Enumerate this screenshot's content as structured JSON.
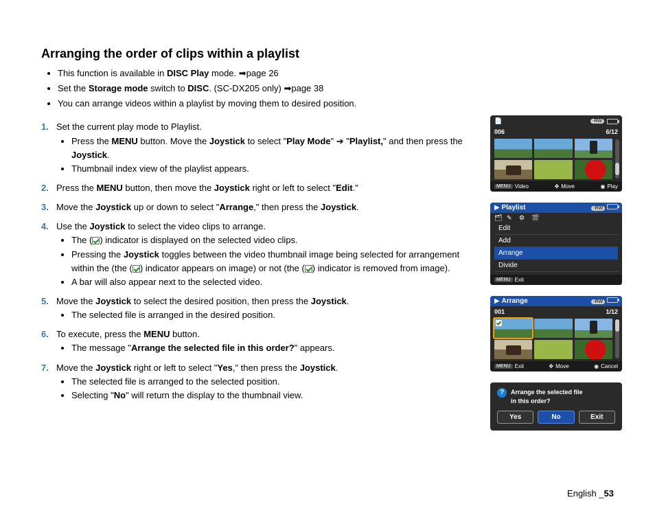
{
  "heading": "Arranging the order of clips within a playlist",
  "intro": [
    {
      "pre": "This function is available in ",
      "b": "DISC Play",
      "post": " mode. ",
      "ref": "page 26"
    },
    {
      "pre": "Set the ",
      "b": "Storage mode",
      "mid": " switch to ",
      "b2": "DISC",
      "post": ". (SC-DX205 only) ",
      "ref": "page 38"
    },
    {
      "pre": "You can arrange videos within a playlist by moving them to desired position."
    }
  ],
  "steps": {
    "s1": {
      "num": "1.",
      "text": "Set the current play mode to Playlist.",
      "sub1_pre": "Press the ",
      "menu": "MENU",
      "sub1_mid1": " button. Move the ",
      "joy": "Joystick",
      "sub1_mid2": " to select \"",
      "playmode": "Play Mode",
      "sub1_mid3": "\" ➔ \"",
      "playlist": "Playlist,",
      "sub1_mid4": "\" and then press the ",
      "sub2": "Thumbnail index view of the playlist appears."
    },
    "s2": {
      "num": "2.",
      "pre": "Press the ",
      "menu": "MENU",
      "mid1": " button, then move the ",
      "joy": "Joystick",
      "mid2": " right or left to select \"",
      "edit": "Edit",
      "post": ".\""
    },
    "s3": {
      "num": "3.",
      "pre": "Move the ",
      "joy": "Joystick",
      "mid1": " up or down to select \"",
      "arrange": "Arrange",
      "mid2": ",\" then press the ",
      "post": "."
    },
    "s4": {
      "num": "4.",
      "pre": "Use the ",
      "joy": "Joystick",
      "post": " to select the video clips to arrange.",
      "sub1_pre": "The (",
      "sub1_post": ") indicator is displayed on the selected video clips.",
      "sub2_pre": "Pressing the ",
      "sub2_mid1": " toggles between the video thumbnail image being selected for arrangement within the (the (",
      "sub2_mid2": ") indicator appears on image) or not (the (",
      "sub2_post": ") indicator is removed from image).",
      "sub3": "A bar will also appear next to the selected video."
    },
    "s5": {
      "num": "5.",
      "pre": "Move the ",
      "joy": "Joystick",
      "mid": " to select the desired position, then press the ",
      "post": ".",
      "sub1": "The selected file is arranged in the desired position."
    },
    "s6": {
      "num": "6.",
      "pre": "To execute, press the ",
      "menu": "MENU",
      "post": " button.",
      "sub1_pre": "The message \"",
      "msg": "Arrange the selected file in this order?",
      "sub1_post": "\" appears."
    },
    "s7": {
      "num": "7.",
      "pre": "Move the ",
      "joy": "Joystick",
      "mid1": " right or left to select \"",
      "yes": "Yes",
      "mid2": ",\" then press the ",
      "post": ".",
      "sub1": "The selected file is arranged to the selected position.",
      "sub2_pre": "Selecting \"",
      "no": "No",
      "sub2_post": "\" will return the display to the thumbnail view."
    }
  },
  "footer": {
    "lang": "English ",
    "sep": "_",
    "page": "53"
  },
  "screens": {
    "s1": {
      "counter_l": "006",
      "counter_r": "6/12",
      "bot_l": "Video",
      "bot_m": "Move",
      "bot_r": "Play",
      "menu": "MENU"
    },
    "s2": {
      "title": "Playlist",
      "items": [
        "Edit",
        "Add",
        "Arrange",
        "Divide"
      ],
      "bot": "Exit",
      "menu": "MENU"
    },
    "s3": {
      "title": "Arrange",
      "counter_l": "001",
      "counter_r": "1/12",
      "bot_l": "Exit",
      "bot_m": "Move",
      "bot_r": "Cancel",
      "menu": "MENU"
    },
    "s4": {
      "msg1": "Arrange the selected file",
      "msg2": "in this order?",
      "yes": "Yes",
      "no": "No",
      "exit": "Exit"
    }
  },
  "rw_label": "-RW"
}
